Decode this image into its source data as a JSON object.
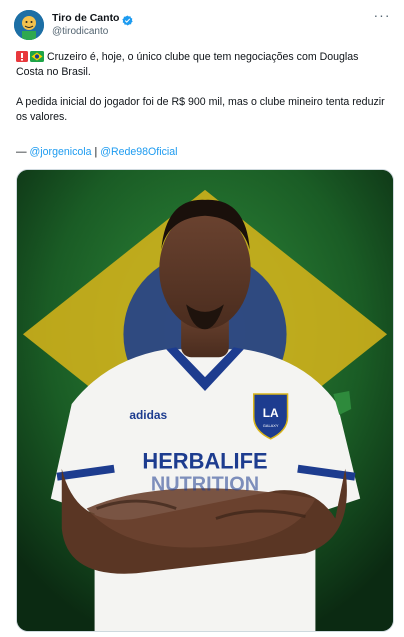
{
  "account": {
    "display_name": "Tiro de Canto",
    "handle": "@tirodicanto",
    "more_label": "···"
  },
  "tweet": {
    "paragraph1": "Cruzeiro é, hoje, o único clube que tem negociações com Douglas Costa no Brasil.",
    "paragraph2": "A pedida inicial do jogador foi de R$ 900 mil, mas o clube mineiro tenta reduzir os valores.",
    "credit_prefix": "— ",
    "credit_link1": "@jorgenicola",
    "credit_sep": " | ",
    "credit_link2": "@Rede98Oficial"
  },
  "media": {
    "jersey_sponsor": "HERBALIFE",
    "jersey_sponsor_line2": "NUTRITION",
    "jersey_brand": "adidas",
    "crest_text": "LA",
    "crest_subtext": "GALAXY",
    "icon": "photo-of-player"
  },
  "colors": {
    "link": "#1d9bf0",
    "verified": "#1d9bf0",
    "text": "#0f1419",
    "muted": "#536471",
    "flag_green": "#1ea448",
    "flag_yellow": "#f4d400",
    "flag_blue": "#1d3c8f"
  }
}
